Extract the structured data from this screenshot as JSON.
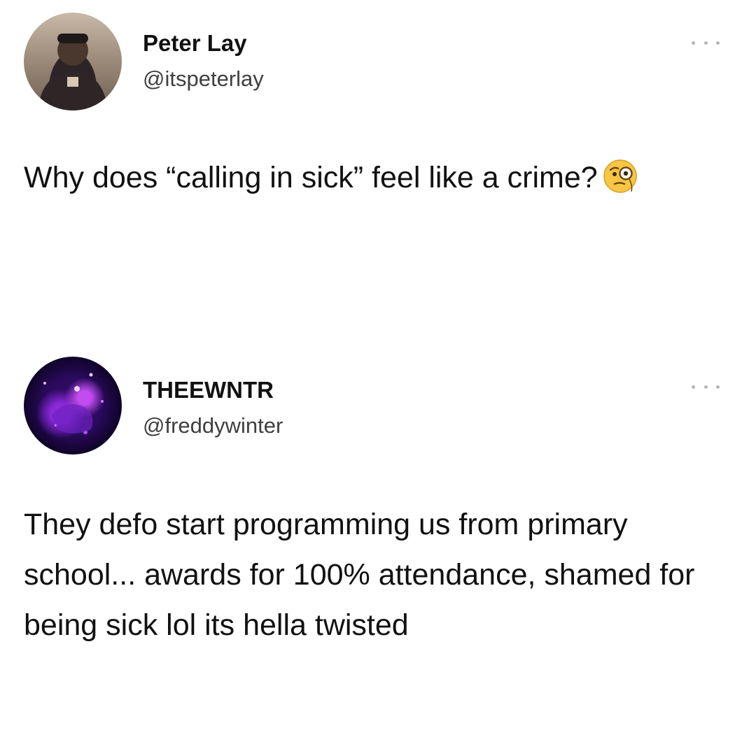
{
  "tweets": [
    {
      "display_name": "Peter Lay",
      "handle": "@itspeterlay",
      "text": "Why does “calling in sick” feel like a crime?",
      "emoji": "face-with-monocle-emoji"
    },
    {
      "display_name": "THEEWNTR",
      "handle": "@freddywinter",
      "text": "They defo start programming us from primary school... awards for 100% attendance, shamed for being sick lol its hella twisted"
    }
  ],
  "colors": {
    "background": "#ffffff",
    "text": "#111111",
    "handle": "#3f3f3f",
    "menu_dots": "#b7b7b7"
  }
}
